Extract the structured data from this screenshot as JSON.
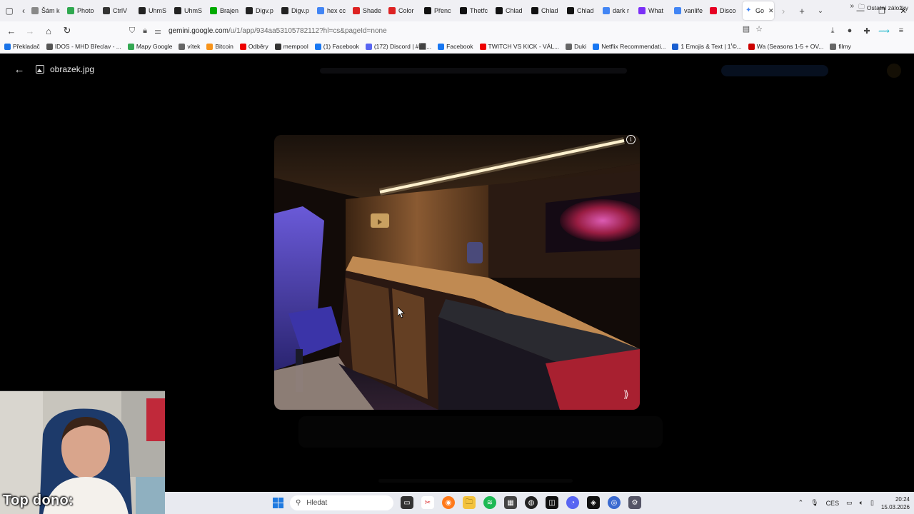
{
  "tabs": [
    {
      "label": "Šám k",
      "color": "#888"
    },
    {
      "label": "Photo",
      "color": "#2fa84f"
    },
    {
      "label": "CtrlV",
      "color": "#333"
    },
    {
      "label": "UhmS",
      "color": "#222"
    },
    {
      "label": "UhmS",
      "color": "#222"
    },
    {
      "label": "Brajen",
      "color": "#0a0"
    },
    {
      "label": "Digv.p",
      "color": "#222"
    },
    {
      "label": "Digv.p",
      "color": "#222"
    },
    {
      "label": "hex cc",
      "color": "#4285f4"
    },
    {
      "label": "Shade",
      "color": "#d22"
    },
    {
      "label": "Color",
      "color": "#d22"
    },
    {
      "label": "Přenc",
      "color": "#111"
    },
    {
      "label": "Thetfc",
      "color": "#111"
    },
    {
      "label": "Chlad",
      "color": "#111"
    },
    {
      "label": "Chlad",
      "color": "#111"
    },
    {
      "label": "Chlad",
      "color": "#111"
    },
    {
      "label": "dark r",
      "color": "#4285f4"
    },
    {
      "label": "What",
      "color": "#7b2ff7"
    },
    {
      "label": "vanlife",
      "color": "#4285f4"
    },
    {
      "label": "Disco",
      "color": "#e60023"
    }
  ],
  "active_tab": {
    "label": "Go",
    "close": "✕"
  },
  "url": {
    "host": "gemini.google.com",
    "path": "/u/1/app/934aa53105782112?hl=cs&pageId=none"
  },
  "bookmarks": [
    {
      "label": "Překladač",
      "color": "#1a73e8"
    },
    {
      "label": "IDOS - MHD Břeclav - ...",
      "color": "#555"
    },
    {
      "label": "Mapy Google",
      "color": "#34a853"
    },
    {
      "label": "vítek",
      "color": "#666"
    },
    {
      "label": "Bitcoin",
      "color": "#f7931a"
    },
    {
      "label": "Odběry",
      "color": "#e00"
    },
    {
      "label": "mempool",
      "color": "#333"
    },
    {
      "label": "(1) Facebook",
      "color": "#1877f2"
    },
    {
      "label": "(172) Discord | #⬛...",
      "color": "#5865f2"
    },
    {
      "label": "Facebook",
      "color": "#1877f2"
    },
    {
      "label": "TWITCH VS KICK - VÁL...",
      "color": "#e00"
    },
    {
      "label": "Duki",
      "color": "#666"
    },
    {
      "label": "Netflix Recommendati...",
      "color": "#1877f2"
    },
    {
      "label": "1 Emojis & Text | 1’́©...",
      "color": "#1a5fd0"
    },
    {
      "label": "Wa (Seasons 1-5 + OV...",
      "color": "#c00"
    },
    {
      "label": "filmy",
      "color": "#666"
    }
  ],
  "bookmarks_other": "Ostatní záložky",
  "viewer": {
    "filename": "obrazek.jpg",
    "back_label": "←"
  },
  "overlay_text": "Top dono:",
  "taskbar": {
    "search_placeholder": "Hledat",
    "language": "CES",
    "time": "20:24",
    "date": "15.03.2026"
  }
}
